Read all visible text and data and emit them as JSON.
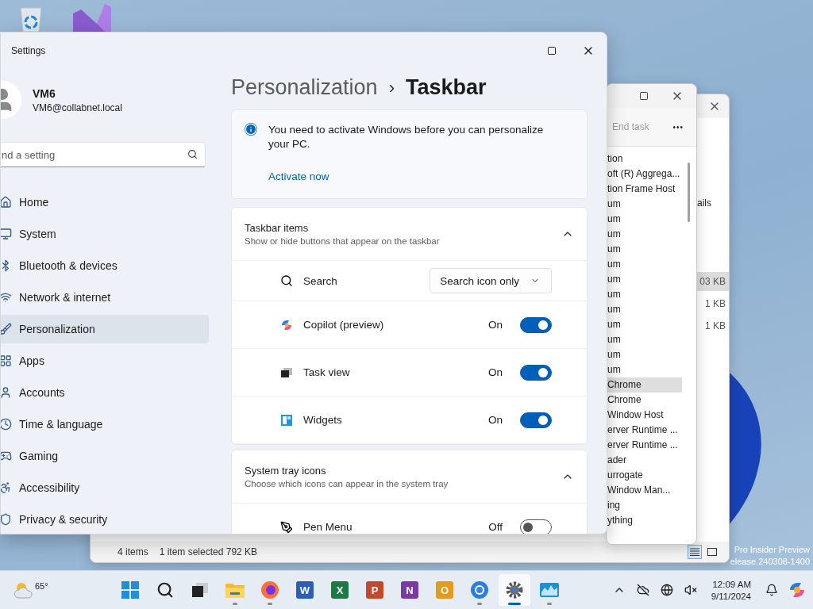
{
  "desktop_watermark": {
    "edition": "Pro Insider Preview",
    "build": "elease.240308-1400"
  },
  "file_explorer": {
    "tab_fragment": "ails",
    "sizes": [
      {
        "text": "03 KB",
        "selected": true
      },
      {
        "text": "1 KB",
        "selected": false
      },
      {
        "text": "1 KB",
        "selected": false
      }
    ],
    "status_bar": {
      "items": "4 items",
      "selection": "1 item selected  792 KB"
    }
  },
  "task_manager": {
    "end_task": {
      "label": "End task",
      "disabled": true
    },
    "more": "•••",
    "processes": [
      {
        "name": "tion",
        "selected": false
      },
      {
        "name": "oft (R) Aggrega...",
        "selected": false
      },
      {
        "name": "tion Frame Host",
        "selected": false
      },
      {
        "name": "um",
        "selected": false
      },
      {
        "name": "um",
        "selected": false
      },
      {
        "name": "um",
        "selected": false
      },
      {
        "name": "um",
        "selected": false
      },
      {
        "name": "um",
        "selected": false
      },
      {
        "name": "um",
        "selected": false
      },
      {
        "name": "um",
        "selected": false
      },
      {
        "name": "um",
        "selected": false
      },
      {
        "name": "um",
        "selected": false
      },
      {
        "name": "um",
        "selected": false
      },
      {
        "name": "um",
        "selected": false
      },
      {
        "name": "um",
        "selected": false
      },
      {
        "name": "Chrome",
        "selected": true
      },
      {
        "name": "Chrome",
        "selected": false
      },
      {
        "name": "Window Host",
        "selected": false
      },
      {
        "name": "erver Runtime ...",
        "selected": false
      },
      {
        "name": "erver Runtime ...",
        "selected": false
      },
      {
        "name": "ader",
        "selected": false
      },
      {
        "name": "urrogate",
        "selected": false
      },
      {
        "name": "Window Man...",
        "selected": false
      },
      {
        "name": "ing",
        "selected": false
      },
      {
        "name": "ything",
        "selected": false
      }
    ]
  },
  "settings": {
    "window": {
      "title": "Settings"
    },
    "profile": {
      "name": "VM6",
      "email": "VM6@collabnet.local"
    },
    "search": {
      "placeholder": "nd a setting"
    },
    "sidebar": {
      "items": [
        {
          "label": "Home",
          "selected": false
        },
        {
          "label": "System",
          "selected": false
        },
        {
          "label": "Bluetooth & devices",
          "selected": false
        },
        {
          "label": "Network & internet",
          "selected": false
        },
        {
          "label": "Personalization",
          "selected": true
        },
        {
          "label": "Apps",
          "selected": false
        },
        {
          "label": "Accounts",
          "selected": false
        },
        {
          "label": "Time & language",
          "selected": false
        },
        {
          "label": "Gaming",
          "selected": false
        },
        {
          "label": "Accessibility",
          "selected": false
        },
        {
          "label": "Privacy & security",
          "selected": false
        }
      ]
    },
    "breadcrumb": {
      "parent": "Personalization",
      "separator": "›",
      "current": "Taskbar"
    },
    "activation_notice": {
      "message": "You need to activate Windows before you can personalize your PC.",
      "link": "Activate now"
    },
    "sections": [
      {
        "title": "Taskbar items",
        "subtitle": "Show or hide buttons that appear on the taskbar",
        "expanded": true,
        "rows": [
          {
            "kind": "dropdown",
            "label": "Search",
            "value": "Search icon only"
          },
          {
            "kind": "toggle",
            "label": "Copilot (preview)",
            "state": "On",
            "on": true
          },
          {
            "kind": "toggle",
            "label": "Task view",
            "state": "On",
            "on": true
          },
          {
            "kind": "toggle",
            "label": "Widgets",
            "state": "On",
            "on": true
          }
        ]
      },
      {
        "title": "System tray icons",
        "subtitle": "Choose which icons can appear in the system tray",
        "expanded": true,
        "rows": [
          {
            "kind": "toggle",
            "label": "Pen Menu",
            "state": "Off",
            "on": false
          }
        ]
      }
    ]
  },
  "taskbar": {
    "weather": {
      "temperature": "65°"
    },
    "apps": [
      {
        "kind": "start",
        "running": false,
        "selected": false
      },
      {
        "kind": "search",
        "running": false,
        "selected": false
      },
      {
        "kind": "taskview",
        "running": false,
        "selected": false
      },
      {
        "kind": "explorer",
        "running": true,
        "selected": false
      },
      {
        "kind": "firefox",
        "running": true,
        "selected": false
      },
      {
        "kind": "office",
        "letter": "W",
        "color": "#2b5eb8",
        "running": false,
        "selected": false
      },
      {
        "kind": "office",
        "letter": "X",
        "color": "#1e7a45",
        "running": false,
        "selected": false
      },
      {
        "kind": "office",
        "letter": "P",
        "color": "#c4482a",
        "running": false,
        "selected": false
      },
      {
        "kind": "office",
        "letter": "N",
        "color": "#7b3aa3",
        "running": false,
        "selected": false
      },
      {
        "kind": "office",
        "letter": "O",
        "color": "#e59a1c",
        "running": false,
        "selected": false
      },
      {
        "kind": "chrome",
        "running": true,
        "selected": false
      },
      {
        "kind": "settings",
        "running": true,
        "selected": true
      },
      {
        "kind": "monitor",
        "running": true,
        "selected": false
      }
    ],
    "clock": {
      "time": "12:09 AM",
      "date": "9/11/2024"
    }
  }
}
